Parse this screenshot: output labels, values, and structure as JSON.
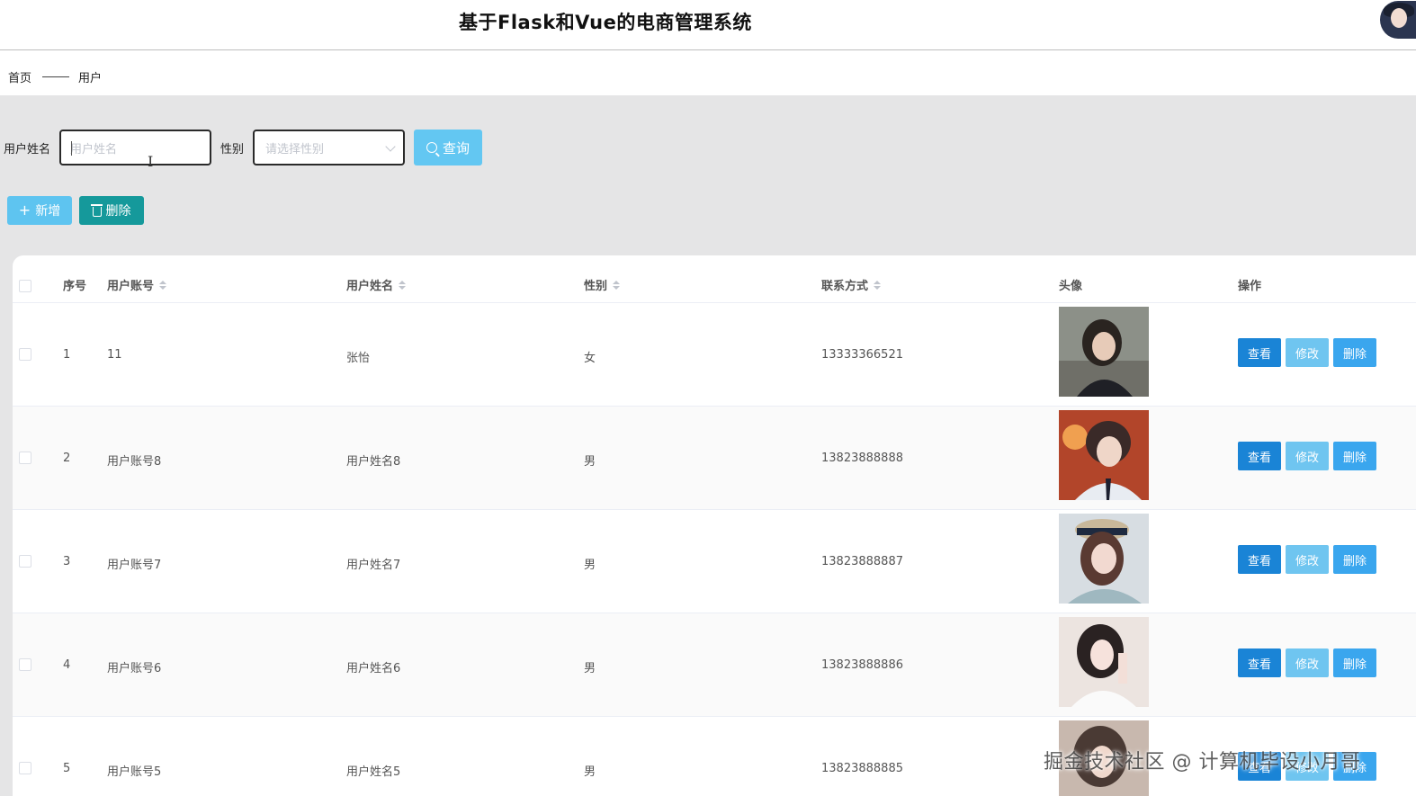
{
  "header": {
    "title": "基于Flask和Vue的电商管理系统"
  },
  "breadcrumb": {
    "home": "首页",
    "current": "用户"
  },
  "search": {
    "name_label": "用户姓名",
    "name_placeholder": "用户姓名",
    "gender_label": "性别",
    "gender_placeholder": "请选择性别",
    "query_label": "查询"
  },
  "actions": {
    "add_label": "新增",
    "delete_label": "删除"
  },
  "table": {
    "columns": {
      "index": "序号",
      "account": "用户账号",
      "name": "用户姓名",
      "gender": "性别",
      "contact": "联系方式",
      "avatar": "头像",
      "ops": "操作"
    },
    "op_labels": {
      "view": "查看",
      "edit": "修改",
      "delete": "删除"
    },
    "rows": [
      {
        "index": "1",
        "account": "11",
        "name": "张怡",
        "gender": "女",
        "contact": "13333366521"
      },
      {
        "index": "2",
        "account": "用户账号8",
        "name": "用户姓名8",
        "gender": "男",
        "contact": "13823888888"
      },
      {
        "index": "3",
        "account": "用户账号7",
        "name": "用户姓名7",
        "gender": "男",
        "contact": "13823888887"
      },
      {
        "index": "4",
        "account": "用户账号6",
        "name": "用户姓名6",
        "gender": "男",
        "contact": "13823888886"
      },
      {
        "index": "5",
        "account": "用户账号5",
        "name": "用户姓名5",
        "gender": "男",
        "contact": "13823888885"
      }
    ]
  },
  "watermark": "掘金技术社区 @ 计算机毕设小月哥",
  "colors": {
    "primary_view": "#1a84d6",
    "edit": "#6fc5f0",
    "delete": "#3aa6ee",
    "add": "#5ec4f0",
    "batch_delete": "#15999b",
    "content_bg": "#e5e5e6"
  }
}
